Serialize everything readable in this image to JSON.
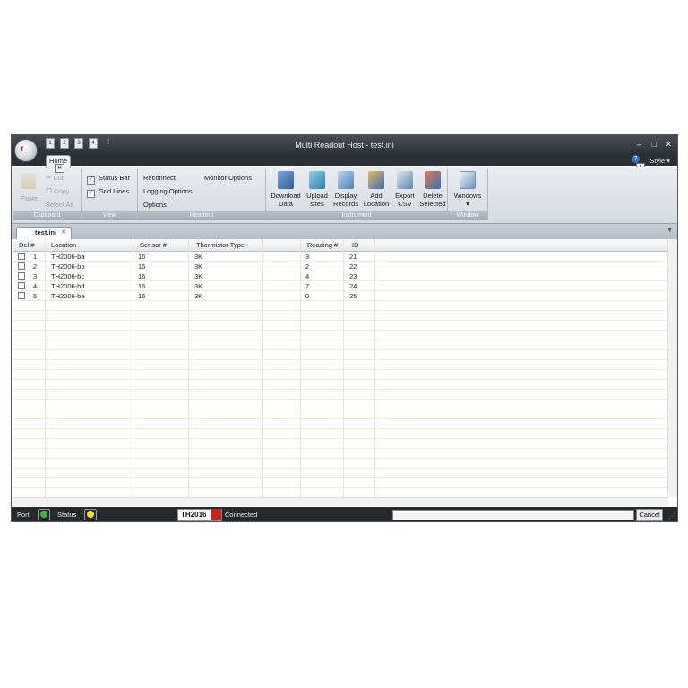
{
  "window": {
    "title": "Multi Readout Host - test.ini",
    "minimize": "–",
    "maximize": "□",
    "close": "✕"
  },
  "app_orb": {
    "letter": "t"
  },
  "quick_access": [
    "1",
    "2",
    "3",
    "4"
  ],
  "quick_access_more": "⁞",
  "ribbon_tabs": {
    "home": "Home",
    "home_keytip": "H"
  },
  "help": {
    "icon": "?",
    "keytip": "A"
  },
  "style_menu": "Style ▾",
  "ribbon": {
    "clipboard": {
      "label": "Clipboard",
      "paste": "Paste",
      "cut": "Cut",
      "copy": "Copy",
      "select_all": "Select All"
    },
    "view": {
      "label": "View",
      "status_bar": "Status Bar",
      "grid_lines": "Grid Lines",
      "status_bar_checked": true,
      "grid_lines_checked": true
    },
    "readout": {
      "label": "Readout",
      "reconnect": "Reconnect",
      "monitor_options": "Monitor Options",
      "logging_options": "Logging Options",
      "options": "Options"
    },
    "instrument": {
      "label": "Instrument",
      "download_data": [
        "Download",
        "Data"
      ],
      "upload_sites": [
        "Upload",
        "sites"
      ],
      "display_records": [
        "Display",
        "Records"
      ],
      "add_location": [
        "Add",
        "Location"
      ],
      "export_csv": [
        "Export",
        "CSV"
      ],
      "delete_selected": [
        "Delete",
        "Selected"
      ]
    },
    "window_group": {
      "label": "Window",
      "windows": "Windows",
      "arrow": "▾"
    }
  },
  "document_tab": {
    "name": "test.ini",
    "close": "✕",
    "dropdown": "▼"
  },
  "table": {
    "headers": [
      "Del #",
      "Location",
      "Sensor #",
      "Thermistor Type",
      "",
      "Reading #",
      "ID"
    ],
    "rows": [
      {
        "del": "1",
        "location": "TH2006-ba",
        "sensor": "16",
        "thermistor": "3K",
        "reading": "3",
        "id": "21"
      },
      {
        "del": "2",
        "location": "TH2006-bb",
        "sensor": "16",
        "thermistor": "3K",
        "reading": "2",
        "id": "22"
      },
      {
        "del": "3",
        "location": "TH2006-bc",
        "sensor": "16",
        "thermistor": "3K",
        "reading": "4",
        "id": "23"
      },
      {
        "del": "4",
        "location": "TH2006-bd",
        "sensor": "16",
        "thermistor": "3K",
        "reading": "7",
        "id": "24"
      },
      {
        "del": "5",
        "location": "TH2006-be",
        "sensor": "16",
        "thermistor": "3K",
        "reading": "0",
        "id": "25"
      }
    ]
  },
  "status_bar": {
    "port_label": "Port",
    "status_label": "Status",
    "port_color": "#3db43a",
    "status_color": "#f2e21a",
    "product": "TH2016",
    "logo_text": "TH\nWS",
    "connection": "Connected",
    "cancel": "Cancel",
    "grip": "⋰"
  }
}
